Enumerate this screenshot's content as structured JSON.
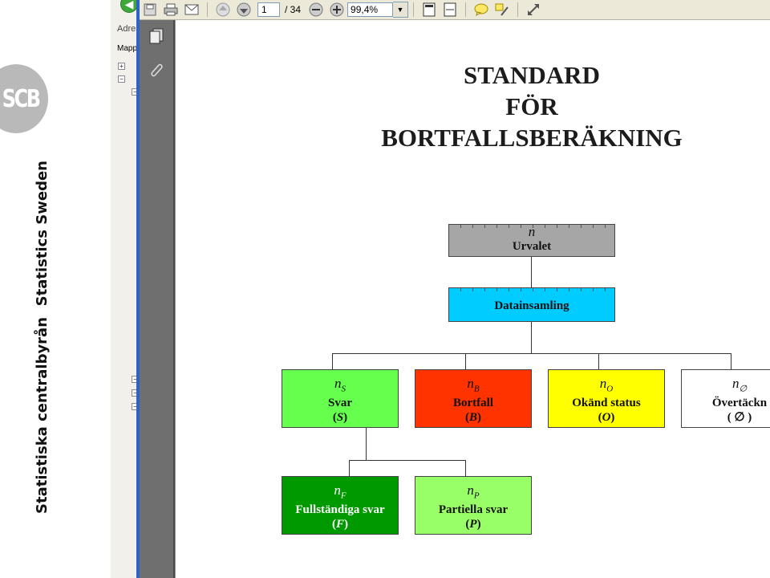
{
  "branding": {
    "logo_text": "SCB",
    "org_swedish": "Statistiska centralbyrån",
    "org_english": "Statistics Sweden"
  },
  "explorer": {
    "address_label": "Adres",
    "folders_label": "Mapp"
  },
  "toolbar": {
    "page_current": "1",
    "page_total": "/ 34",
    "zoom": "99,4%",
    "icons": [
      "save-icon",
      "print-icon",
      "email-icon",
      "prev-page-icon",
      "next-page-icon",
      "zoom-out-icon",
      "zoom-in-icon",
      "fit-page-icon",
      "fit-width-icon",
      "comment-icon",
      "highlight-icon",
      "expand-icon"
    ]
  },
  "document": {
    "title_lines": [
      "STANDARD",
      "FÖR",
      "BORTFALLSBERÄKNING"
    ],
    "nodes": {
      "sample": {
        "symbol": "n",
        "sub": "",
        "name": "Urvalet",
        "code": "",
        "color": "#a6a6a6"
      },
      "collection": {
        "name": "Datainsamling",
        "color": "#00ccff"
      },
      "response": {
        "symbol": "n",
        "sub": "S",
        "name": "Svar",
        "code": "S",
        "color": "#66ff4d"
      },
      "nonresponse": {
        "symbol": "n",
        "sub": "B",
        "name": "Bortfall",
        "code": "B",
        "color": "#ff3300"
      },
      "unknown": {
        "symbol": "n",
        "sub": "O",
        "name": "Okänd status",
        "code": "O",
        "color": "#ffff00"
      },
      "overcoverage": {
        "symbol": "n",
        "sub": "∅",
        "name": "Övertäckn",
        "code": "∅",
        "color": "#ffffff"
      },
      "full": {
        "symbol": "n",
        "sub": "F",
        "name": "Fullständiga svar",
        "code": "F",
        "color": "#009900"
      },
      "partial": {
        "symbol": "n",
        "sub": "P",
        "name": "Partiella svar",
        "code": "P",
        "color": "#99ff66"
      }
    }
  }
}
